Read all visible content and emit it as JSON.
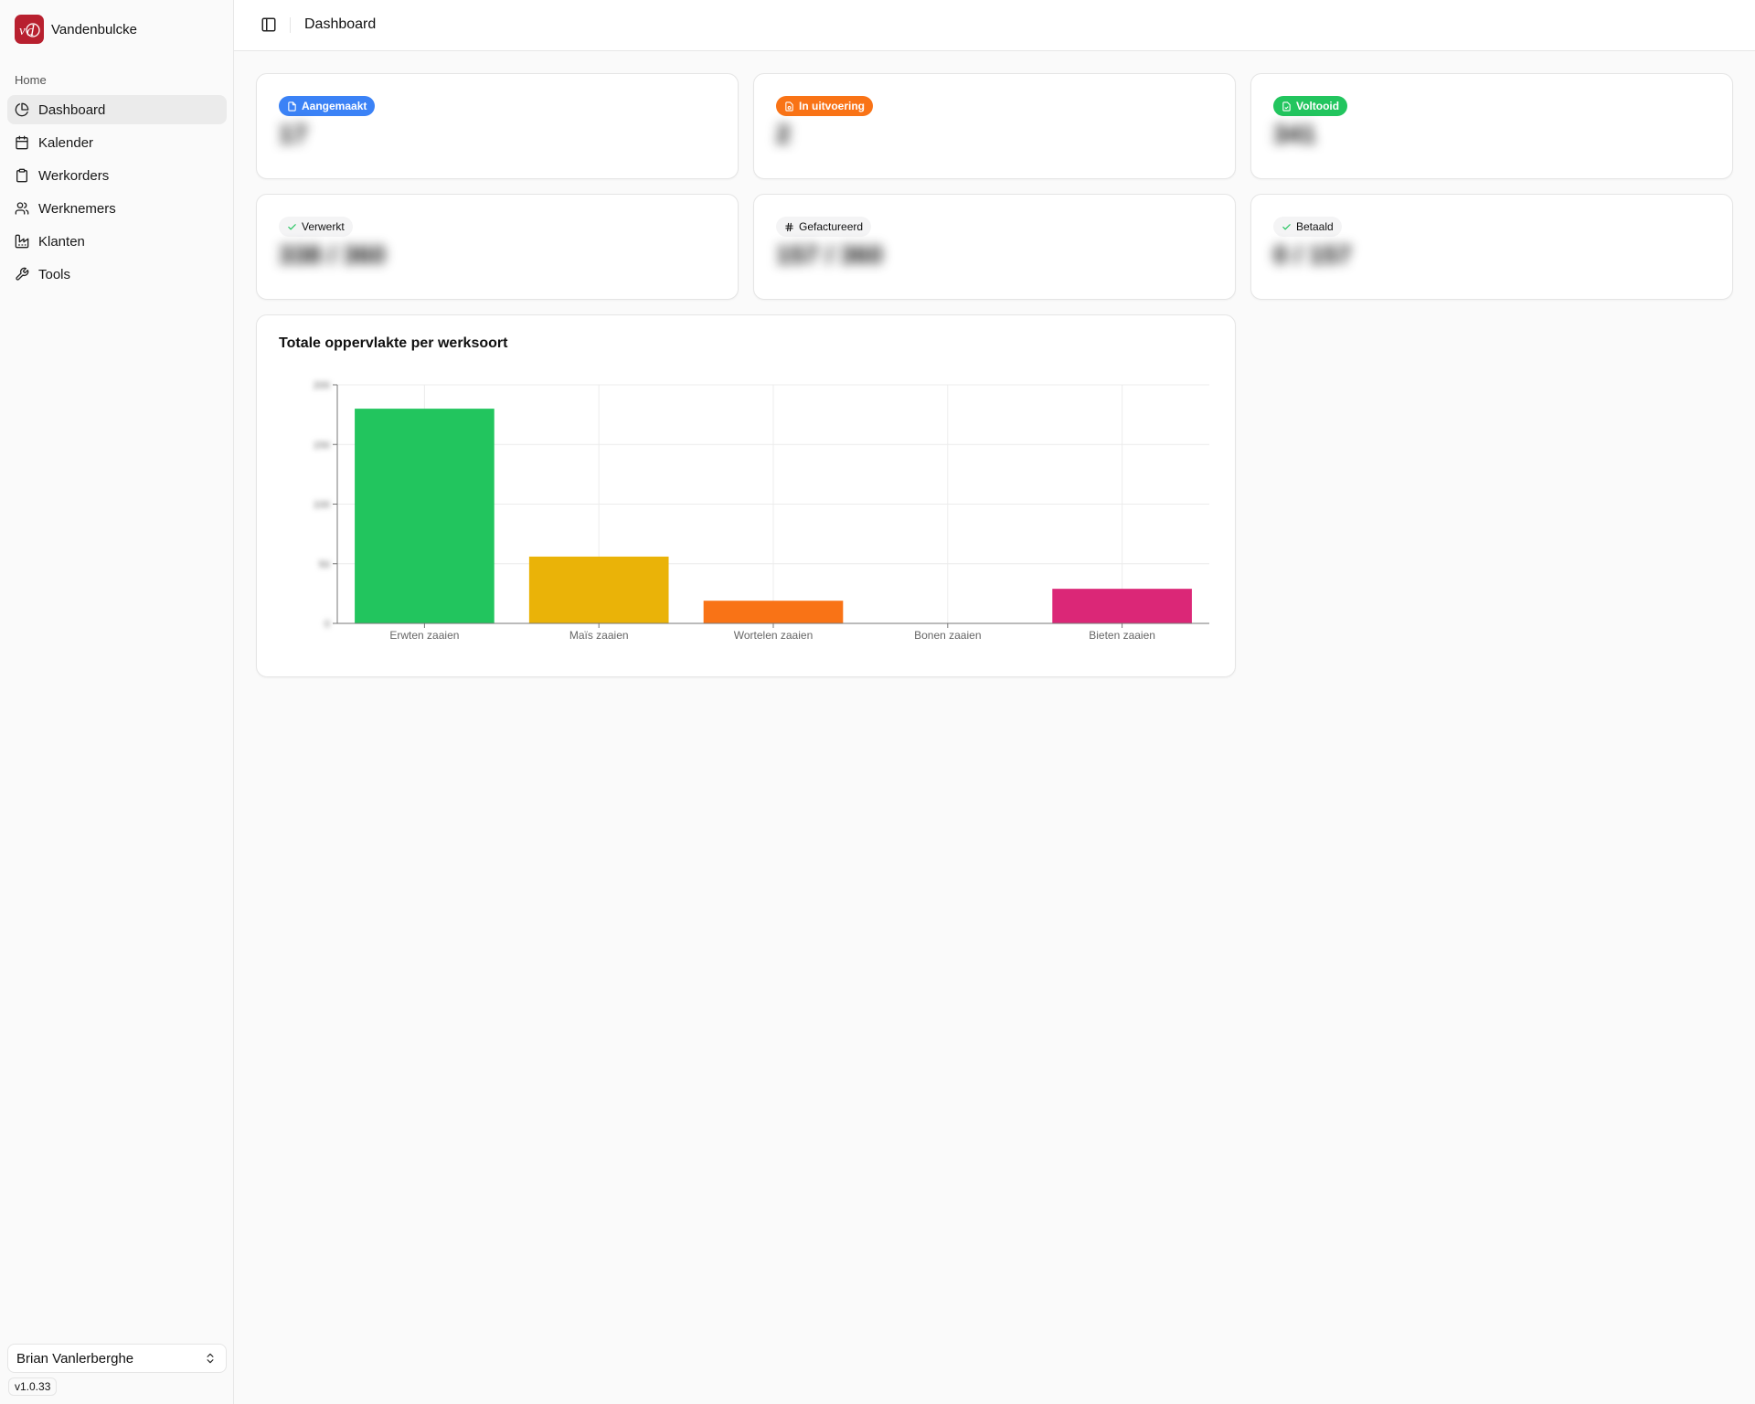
{
  "sidebar": {
    "brand_name": "Vandenbulcke",
    "group_label": "Home",
    "items": [
      {
        "label": "Dashboard",
        "icon": "pie-chart-icon",
        "active": true
      },
      {
        "label": "Kalender",
        "icon": "calendar-icon",
        "active": false
      },
      {
        "label": "Werkorders",
        "icon": "clipboard-icon",
        "active": false
      },
      {
        "label": "Werknemers",
        "icon": "users-icon",
        "active": false
      },
      {
        "label": "Klanten",
        "icon": "factory-icon",
        "active": false
      },
      {
        "label": "Tools",
        "icon": "wrench-icon",
        "active": false
      }
    ],
    "user_name": "Brian Vanlerberghe",
    "version": "v1.0.33"
  },
  "header": {
    "title": "Dashboard"
  },
  "stats": [
    {
      "label": "Aangemaakt",
      "value": "17",
      "color": "#3b82f6",
      "icon": "file-icon"
    },
    {
      "label": "In uitvoering",
      "value": "2",
      "color": "#f97316",
      "icon": "file-clock-icon"
    },
    {
      "label": "Voltooid",
      "value": "341",
      "color": "#22c55e",
      "icon": "file-check-icon"
    },
    {
      "label": "Verwerkt",
      "value": "338 / 360",
      "color": "#22c55e",
      "icon": "check-icon"
    },
    {
      "label": "Gefactureerd",
      "value": "157 / 360",
      "color": "#111111",
      "icon": "hash-icon"
    },
    {
      "label": "Betaald",
      "value": "0 / 157",
      "color": "#22c55e",
      "icon": "check-icon"
    }
  ],
  "chart_data": {
    "type": "bar",
    "title": "Totale oppervlakte per werksoort",
    "categories": [
      "Erwten zaaien",
      "Maïs zaaien",
      "Wortelen zaaien",
      "Bonen zaaien",
      "Bieten zaaien"
    ],
    "values": [
      180,
      56,
      19,
      0,
      29
    ],
    "colors": [
      "#22c55e",
      "#eab308",
      "#f97316",
      "#0ea5e9",
      "#db2777"
    ],
    "yticks": [
      "200",
      "150",
      "100",
      "50",
      "0"
    ],
    "ylim": [
      0,
      200
    ],
    "grid": true
  }
}
